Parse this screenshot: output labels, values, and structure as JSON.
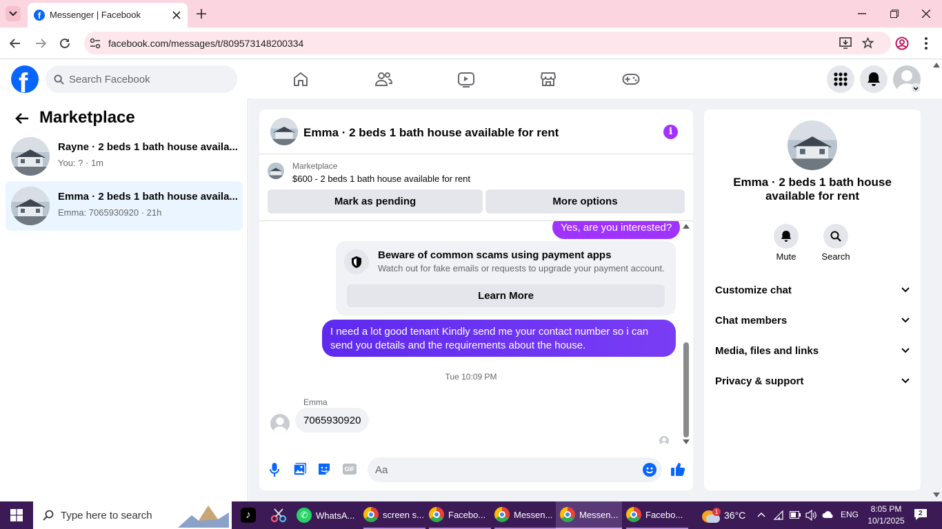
{
  "browser": {
    "tab_title": "Messenger | Facebook",
    "url": "facebook.com/messages/t/809573148200334"
  },
  "fb": {
    "search_placeholder": "Search Facebook"
  },
  "left_panel": {
    "title": "Marketplace",
    "conversations": [
      {
        "name": "Rayne · 2 beds 1 bath house availa...",
        "sub": "You: ? · 1m"
      },
      {
        "name": "Emma · 2 beds 1 bath house availa...",
        "sub": "Emma: 7065930920 · 21h"
      }
    ]
  },
  "chat": {
    "title": "Emma · 2 beds 1 bath house available for rent",
    "listing_source": "Marketplace",
    "listing_title": "$600 - 2 beds 1 bath house available for rent",
    "mark_pending": "Mark as pending",
    "more_options": "More options",
    "msg_out_1": "Yes, are you interested?",
    "warning_title": "Beware of common scams using payment apps",
    "warning_body": "Watch out for fake emails or requests to upgrade your payment account.",
    "learn_more": "Learn More",
    "msg_out_2": "I need a lot good tenant Kindly send me your contact number so i can send you details and the requirements about the house.",
    "timestamp": "Tue 10:09 PM",
    "sender_name": "Emma",
    "msg_in_1": "7065930920",
    "composer_placeholder": "Aa"
  },
  "right_panel": {
    "title": "Emma · 2 beds 1 bath house available for rent",
    "mute": "Mute",
    "search": "Search",
    "sections": [
      "Customize chat",
      "Chat members",
      "Media, files and links",
      "Privacy & support"
    ]
  },
  "taskbar": {
    "search_placeholder": "Type here to search",
    "apps": [
      "WhatsA...",
      "screen s...",
      "Facebo...",
      "Messen...",
      "Messen...",
      "Facebo..."
    ],
    "weather_badge": "1",
    "temperature": "36°C",
    "language": "ENG",
    "time": "8:05 PM",
    "date": "10/1/2025",
    "notification_count": "2"
  },
  "colors": {
    "fb_blue": "#0866ff",
    "messenger_purple": "#a033ff",
    "tab_strip": "#fbd5df",
    "taskbar": "#3b1a56"
  }
}
